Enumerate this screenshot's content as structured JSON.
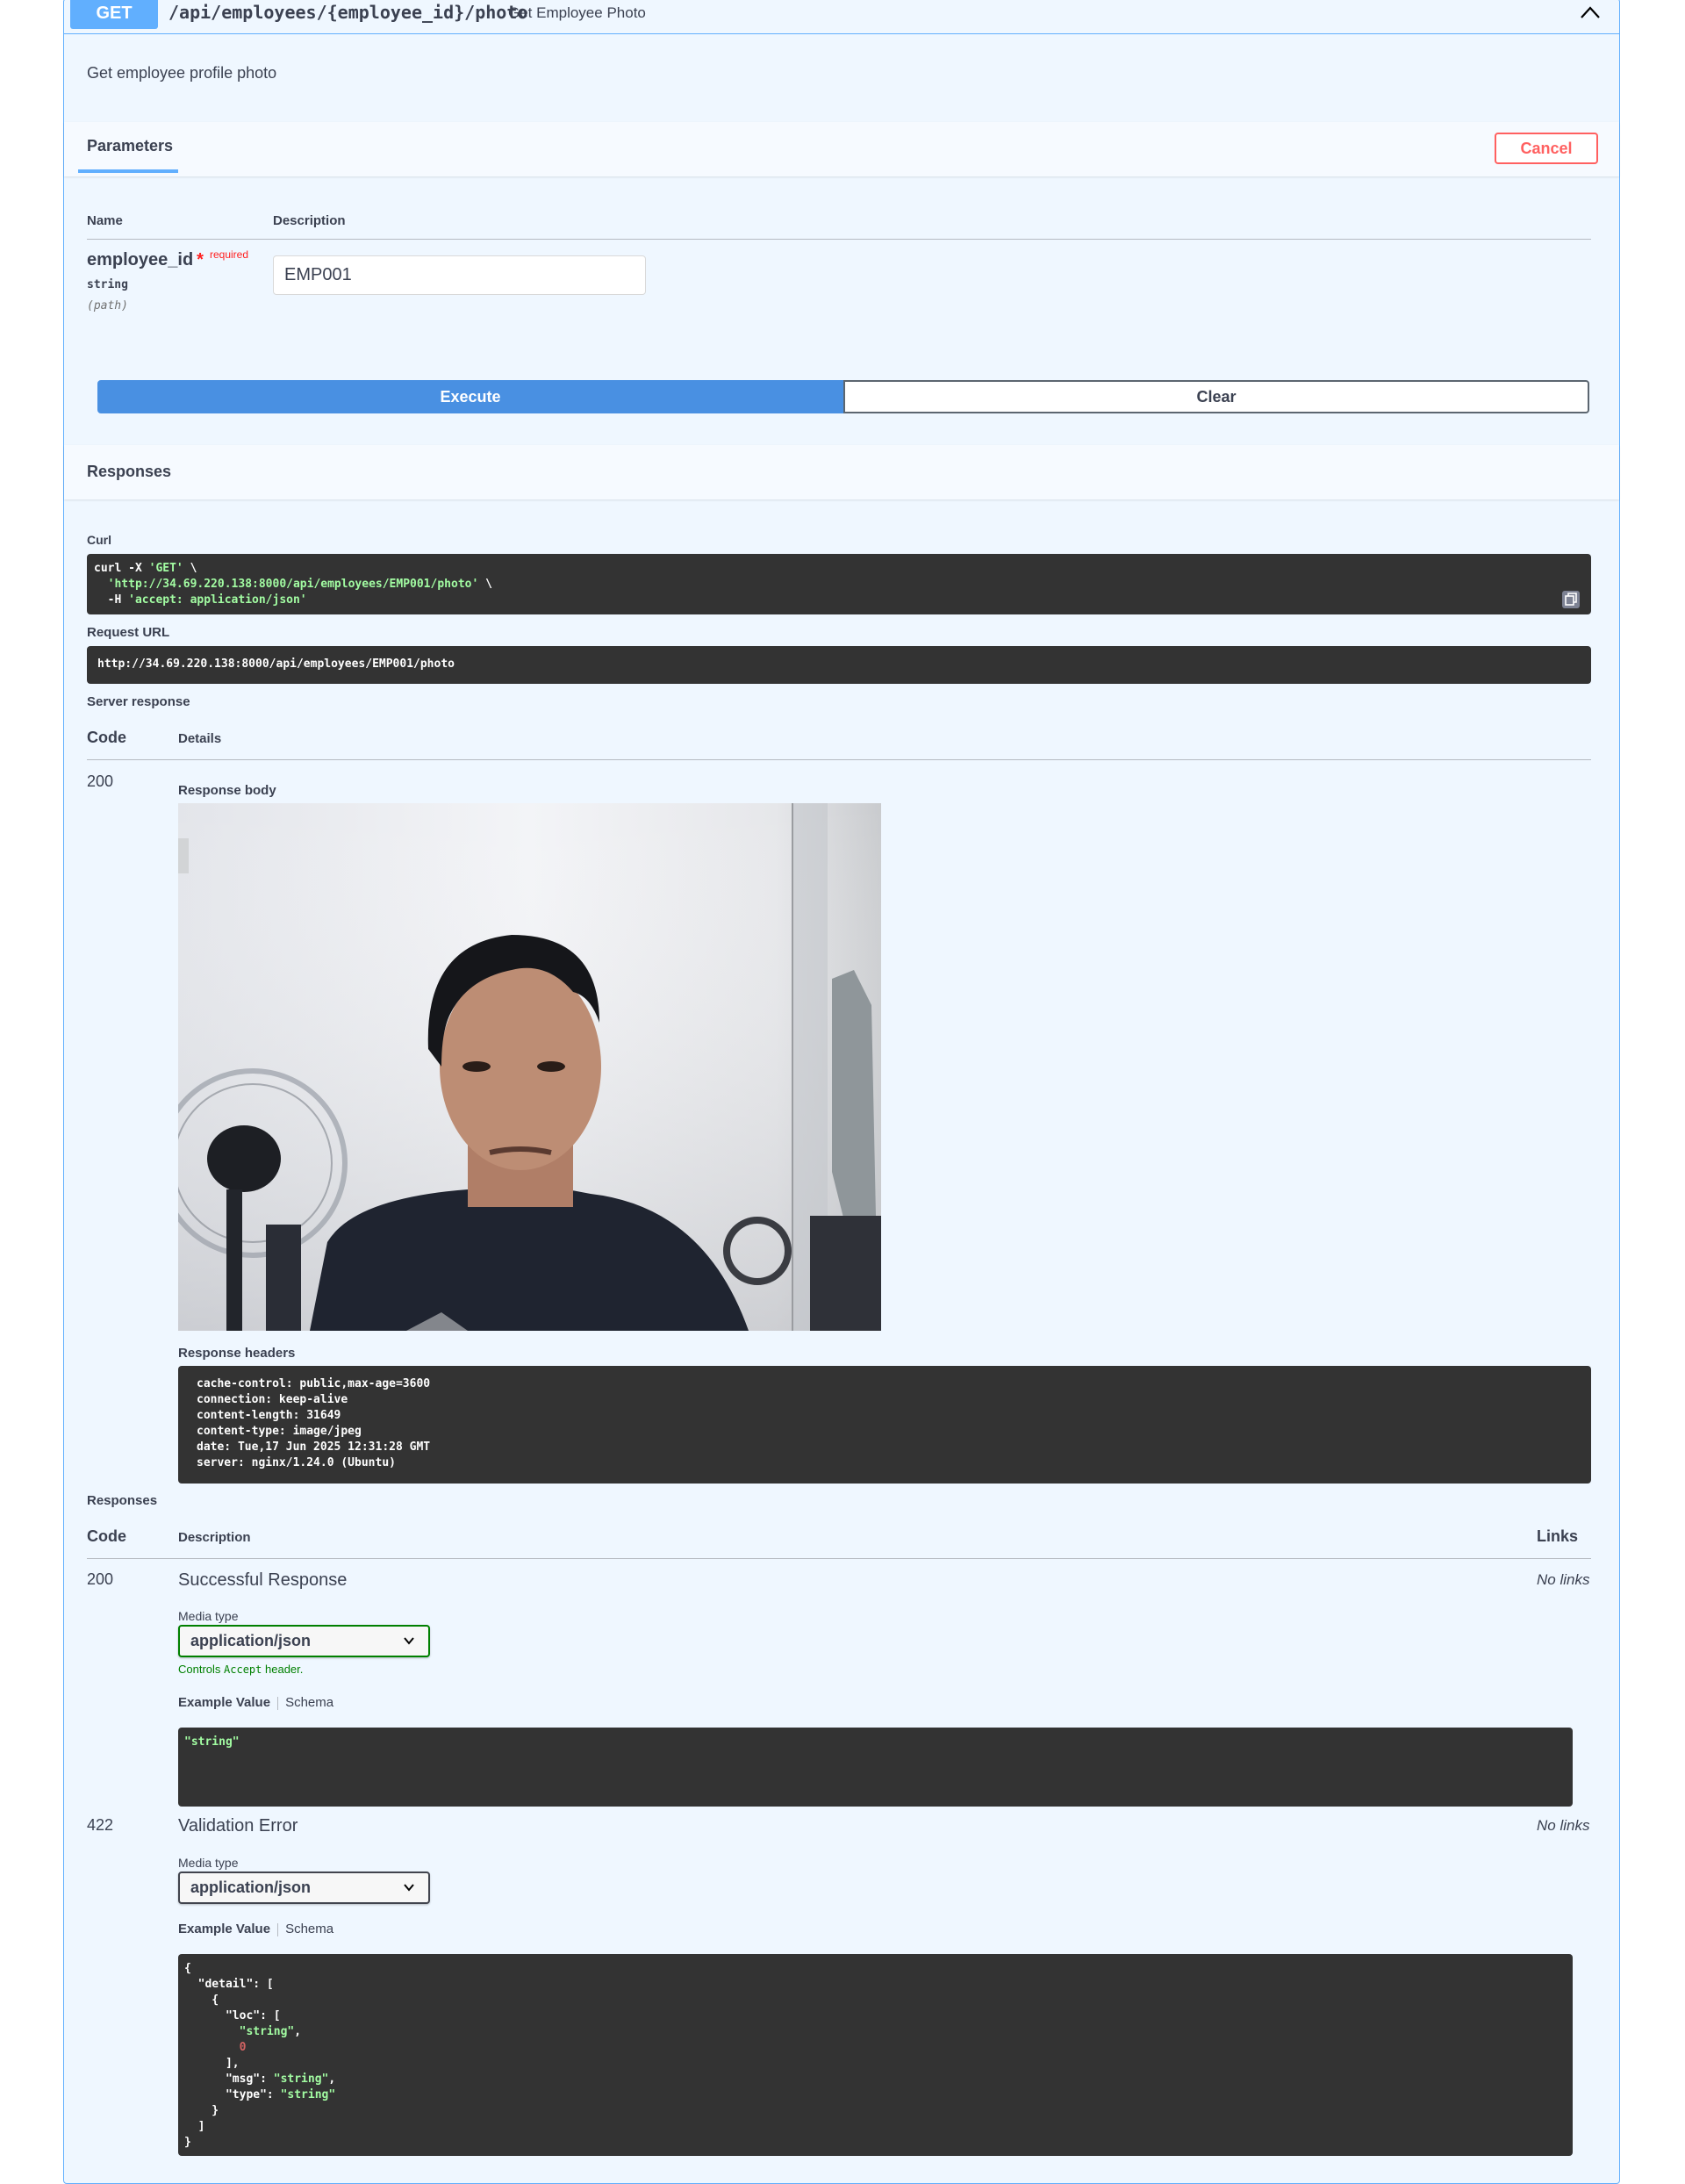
{
  "operation": {
    "method": "GET",
    "path": "/api/employees/{employee_id}/photo",
    "summary": "Get Employee Photo",
    "description": "Get employee profile photo"
  },
  "parameters": {
    "tab_label": "Parameters",
    "cancel_label": "Cancel",
    "col_name": "Name",
    "col_description": "Description",
    "param": {
      "name": "employee_id",
      "required_star": "*",
      "required_label": "required",
      "type": "string",
      "location": "(path)",
      "value": "EMP001"
    },
    "execute_label": "Execute",
    "clear_label": "Clear"
  },
  "live_response": {
    "title": "Responses",
    "curl_label": "Curl",
    "curl": {
      "line1_cmd": "curl -X ",
      "line1_method": "'GET'",
      "line1_tail": " \\",
      "line2_url": "'http://34.69.220.138:8000/api/employees/EMP001/photo'",
      "line2_tail": " \\",
      "line3_flag": "  -H ",
      "line3_header": "'accept: application/json'"
    },
    "request_url_label": "Request URL",
    "request_url": "http://34.69.220.138:8000/api/employees/EMP001/photo",
    "server_response_label": "Server response",
    "col_code": "Code",
    "col_details": "Details",
    "code": "200",
    "response_body_label": "Response body",
    "response_headers_label": "Response headers",
    "headers": [
      "cache-control: public,max-age=3600",
      "connection: keep-alive",
      "content-length: 31649",
      "content-type: image/jpeg",
      "date: Tue,17 Jun 2025 12:31:28 GMT",
      "server: nginx/1.24.0 (Ubuntu)"
    ]
  },
  "documented_responses": {
    "title": "Responses",
    "col_code": "Code",
    "col_description": "Description",
    "col_links": "Links",
    "media_type_label": "Media type",
    "controls_prefix": "Controls ",
    "controls_code": "Accept",
    "controls_suffix": " header.",
    "example_value_label": "Example Value",
    "schema_label": "Schema",
    "r200": {
      "code": "200",
      "description": "Successful Response",
      "links": "No links",
      "media_type": "application/json",
      "example": "\"string\""
    },
    "r422": {
      "code": "422",
      "description": "Validation Error",
      "links": "No links",
      "media_type": "application/json",
      "example": {
        "l1": "{",
        "l2_key": "  \"detail\": [",
        "l3": "    {",
        "l4_key": "      \"loc\": [",
        "l5_str": "\"string\"",
        "l5_tail": ",",
        "l6_num": "0",
        "l7": "      ],",
        "l8_key": "      \"msg\": ",
        "l8_str": "\"string\"",
        "l8_tail": ",",
        "l9_key": "      \"type\": ",
        "l9_str": "\"string\"",
        "l10": "    }",
        "l11": "  ]",
        "l12": "}"
      }
    }
  },
  "colors": {
    "get_blue": "#61affe",
    "execute_blue": "#4990e2",
    "cancel_red": "#ff6060",
    "code_bg": "#333333",
    "string_green": "#a2fca2"
  }
}
